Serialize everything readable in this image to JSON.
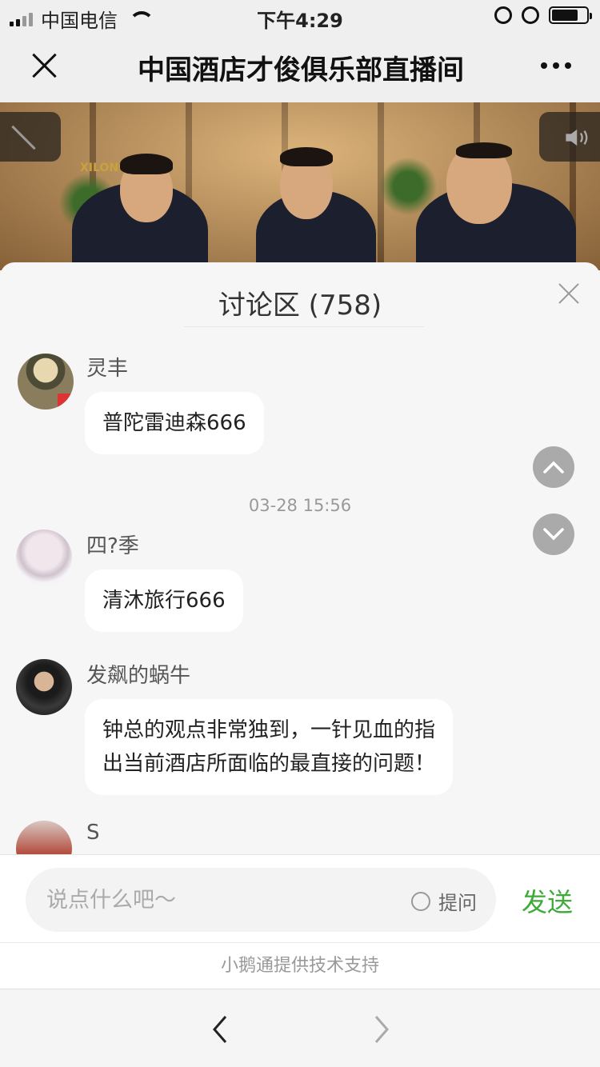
{
  "status_bar": {
    "carrier": "中国电信",
    "time": "下午4:29",
    "battery_level": 0.75
  },
  "nav": {
    "title": "中国酒店才俊俱乐部直播间"
  },
  "video": {
    "logo_text": "XILONG"
  },
  "panel": {
    "title": "讨论区 (758)"
  },
  "messages": [
    {
      "name": "灵丰",
      "text": "普陀雷迪森666"
    },
    {
      "name": "四?季",
      "text": "清沐旅行666"
    },
    {
      "name": "发飙的蜗牛",
      "text_line1": "钟总的观点非常独到，一针见血的指",
      "text_line2": "出当前酒店所面临的最直接的问题！"
    },
    {
      "name": "S"
    }
  ],
  "timestamp": "03-28 15:56",
  "input": {
    "placeholder": "说点什么吧～",
    "ask_label": "提问",
    "send_label": "发送"
  },
  "support_text": "小鹅通提供技术支持",
  "icons": {
    "close": "close-icon",
    "more": "more-icon",
    "expand": "expand-icon",
    "speaker": "speaker-icon",
    "scroll_up": "chevron-up-icon",
    "scroll_down": "chevron-down-icon",
    "back": "chevron-left-icon",
    "forward": "chevron-right-icon"
  },
  "colors": {
    "send": "#3eaa3a",
    "panel_bg": "#f6f6f6"
  }
}
